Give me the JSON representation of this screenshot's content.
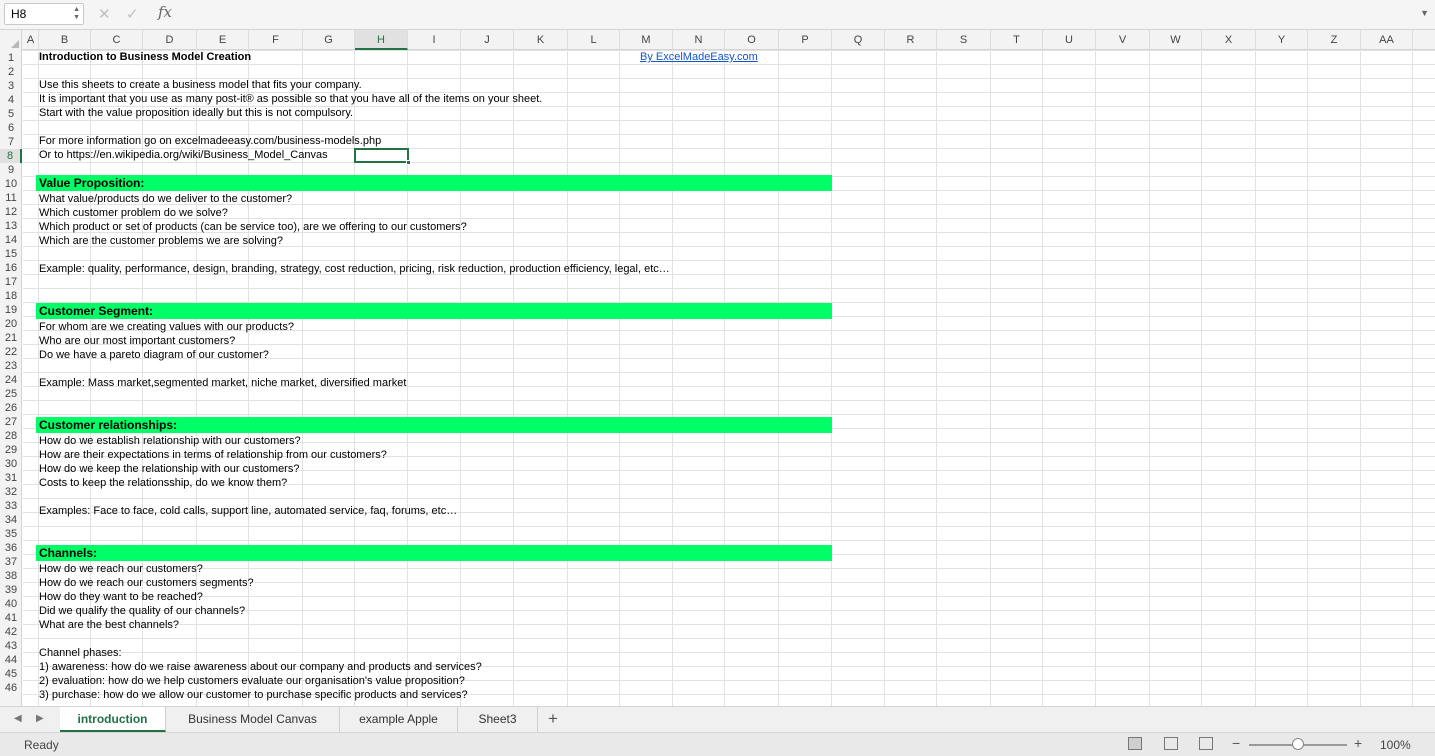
{
  "formula_bar": {
    "name_box": "H8",
    "cancel_icon": "x-icon",
    "confirm_icon": "check-icon",
    "function_label": "fx",
    "formula_value": ""
  },
  "columns": [
    "A",
    "B",
    "C",
    "D",
    "E",
    "F",
    "G",
    "H",
    "I",
    "J",
    "K",
    "L",
    "M",
    "N",
    "O",
    "P",
    "Q",
    "R",
    "S",
    "T",
    "U",
    "V",
    "W",
    "X",
    "Y",
    "Z",
    "AA"
  ],
  "selected_column": "H",
  "rows": [
    "1",
    "2",
    "3",
    "4",
    "5",
    "6",
    "7",
    "8",
    "9",
    "10",
    "11",
    "12",
    "13",
    "14",
    "15",
    "16",
    "17",
    "18",
    "19",
    "20",
    "21",
    "22",
    "23",
    "24",
    "25",
    "26",
    "27",
    "28",
    "29",
    "30",
    "31",
    "32",
    "33",
    "34",
    "35",
    "36",
    "37",
    "38",
    "39",
    "40",
    "41",
    "42",
    "43",
    "44",
    "45",
    "46"
  ],
  "selected_row": "8",
  "sheet": {
    "title": "Introduction to Business Model Creation",
    "link": "By ExcelMadeEasy.com",
    "intro": [
      "Use this sheets to create a business model that fits your company.",
      "It is important that you use as many post-it® as possible so that you have all of the items on your sheet.",
      "Start with the value proposition ideally but this is not compulsory.",
      "For more information go on excelmadeeasy.com/business-models.php",
      "Or to https://en.wikipedia.org/wiki/Business_Model_Canvas"
    ],
    "value_proposition": {
      "header": "Value Proposition:",
      "lines": [
        "What value/products do we deliver to the customer?",
        "Which customer problem do we solve?",
        "Which product or set of products (can be service too), are we offering to our customers?",
        "Which are the customer problems we are solving?"
      ],
      "example": "Example: quality, performance, design, branding, strategy, cost reduction, pricing, risk reduction, production efficiency, legal, etc…"
    },
    "customer_segment": {
      "header": "Customer Segment:",
      "lines": [
        "For whom are we creating values with our products?",
        "Who are our most important customers?",
        "Do we have a pareto diagram of our customer?"
      ],
      "example": "Example: Mass market,segmented market, niche market, diversified market"
    },
    "customer_relationships": {
      "header": "Customer relationships:",
      "lines": [
        "How do we establish relationship with our customers?",
        "How are their expectations in terms of relationship from our customers?",
        "How do we keep the relationship with our customers?",
        "Costs to keep the relationsship, do we know them?"
      ],
      "example": "Examples: Face to face, cold calls, support line, automated service, faq, forums, etc…"
    },
    "channels": {
      "header": "Channels:",
      "lines": [
        "How do we reach our customers?",
        "How do we reach our customers segments?",
        "How do they want to be reached?",
        "Did we qualify the quality of our channels?",
        "What are the best channels?"
      ],
      "phases_label": "Channel phases:",
      "phases": [
        "1) awareness: how do we raise awareness about our company and products and services?",
        "2) evaluation: how do we help customers evaluate our organisation's value proposition?",
        "3) purchase: how do we allow our customer to purchase specific products and services?"
      ]
    }
  },
  "tabs": {
    "items": [
      "introduction",
      "Business Model Canvas",
      "example Apple",
      "Sheet3"
    ],
    "active": "introduction",
    "add_label": "+"
  },
  "status": {
    "text": "Ready",
    "zoom": "100%",
    "zoom_percent": 100
  },
  "colors": {
    "section_band": "#00ff66",
    "accent": "#217346",
    "link": "#1155cc"
  }
}
